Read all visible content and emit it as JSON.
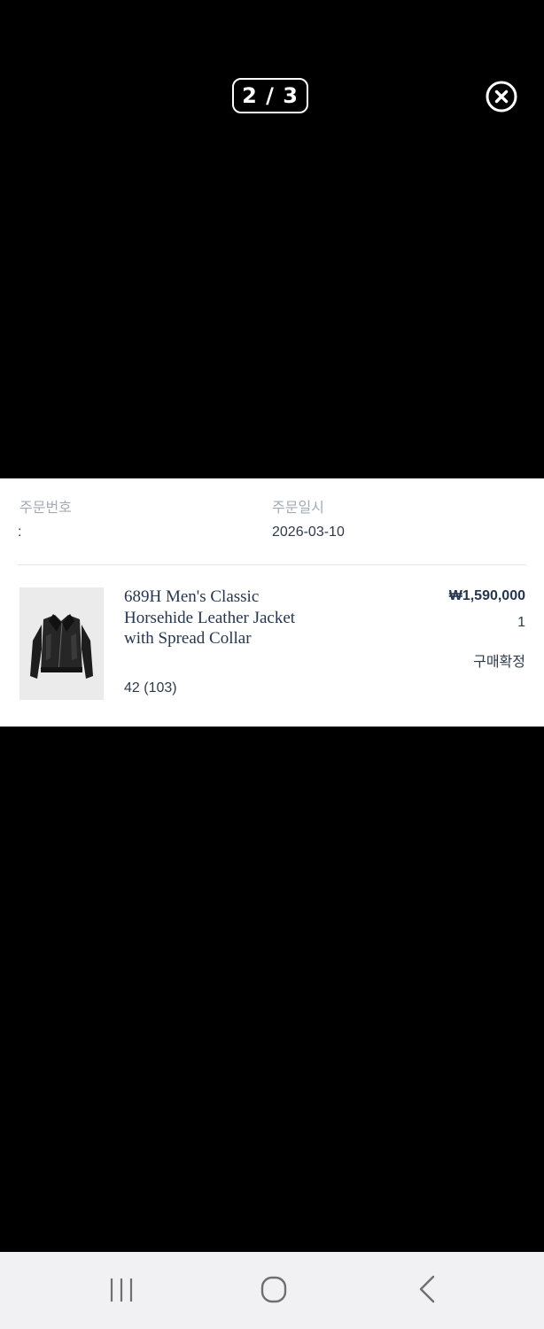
{
  "viewer": {
    "counter": "2 / 3",
    "close_icon": "close-circle-icon"
  },
  "order": {
    "number_label": "주문번호",
    "number_value": ":",
    "date_label": "주문일시",
    "date_value": "2026-03-10"
  },
  "product": {
    "image_icon": "leather-jacket-image",
    "name": "689H Men's Classic Horsehide Leather Jacket with Spread Collar",
    "option": "42 (103)",
    "price": "₩1,590,000",
    "quantity": "1",
    "status": "구매확정"
  },
  "system_nav": {
    "recents_icon": "recent-apps-icon",
    "home_icon": "home-icon",
    "back_icon": "back-icon"
  },
  "colors": {
    "background": "#000000",
    "card": "#ffffff",
    "text_primary": "#243650",
    "text_muted": "#a3abb5",
    "navbar": "#f1f1f3"
  }
}
